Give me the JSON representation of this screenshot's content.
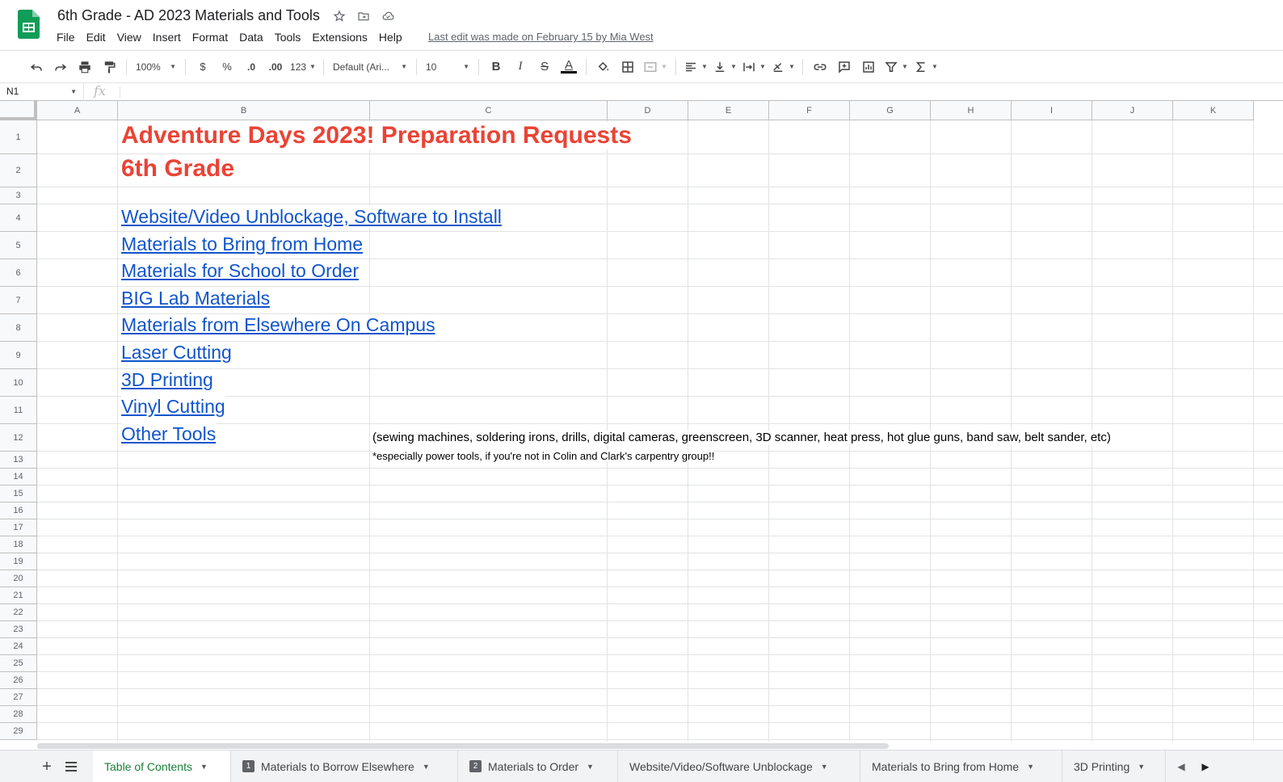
{
  "doc": {
    "title": "6th Grade - AD 2023 Materials and Tools",
    "last_edit": "Last edit was made on February 15 by Mia West"
  },
  "menu": [
    "File",
    "Edit",
    "View",
    "Insert",
    "Format",
    "Data",
    "Tools",
    "Extensions",
    "Help"
  ],
  "toolbar": {
    "zoom": "100%",
    "currency": "$",
    "percent": "%",
    "decrease_decimal": ".0",
    "increase_decimal": ".00",
    "more_formats": "123",
    "font": "Default (Ari...",
    "font_size": "10",
    "bold": "B",
    "italic": "I",
    "strike": "S",
    "text_color": "A",
    "text_color_value": "#000000"
  },
  "formula_bar": {
    "cell_ref": "N1",
    "fx": "fx",
    "value": ""
  },
  "columns": [
    "A",
    "B",
    "C",
    "D",
    "E",
    "F",
    "G",
    "H",
    "I",
    "J",
    "K"
  ],
  "rows": [
    "1",
    "2",
    "3",
    "4",
    "5",
    "6",
    "7",
    "8",
    "9",
    "10",
    "11",
    "12",
    "13",
    "14",
    "15",
    "16",
    "17",
    "18",
    "19",
    "20",
    "21",
    "22",
    "23",
    "24",
    "25",
    "26",
    "27",
    "28",
    "29"
  ],
  "cells": {
    "title": "Adventure Days 2023! Preparation Requests",
    "subtitle": "6th Grade",
    "links": [
      "Website/Video Unblockage, Software to Install",
      "Materials to Bring from Home",
      "Materials for School to Order",
      "BIG Lab Materials",
      "Materials from Elsewhere On Campus",
      "Laser Cutting",
      "3D Printing",
      "Vinyl Cutting",
      "Other Tools"
    ],
    "note": "(sewing machines, soldering irons, drills, digital cameras, greenscreen, 3D scanner, heat press, hot glue guns, band saw, belt sander, etc)",
    "note2": "*especially power tools, if you're not in Colin and Clark's carpentry group!!"
  },
  "colors": {
    "title_red": "#ea4335",
    "link_blue": "#1155cc",
    "active_tab_green": "#188038"
  },
  "tabs": [
    {
      "label": "Table of Contents",
      "num": "",
      "active": true
    },
    {
      "label": "Materials to Borrow Elsewhere",
      "num": "1",
      "active": false
    },
    {
      "label": "Materials to Order",
      "num": "2",
      "active": false
    },
    {
      "label": "Website/Video/Software Unblockage",
      "num": "",
      "active": false
    },
    {
      "label": "Materials to Bring from Home",
      "num": "",
      "active": false
    },
    {
      "label": "3D Printing",
      "num": "",
      "active": false
    }
  ]
}
